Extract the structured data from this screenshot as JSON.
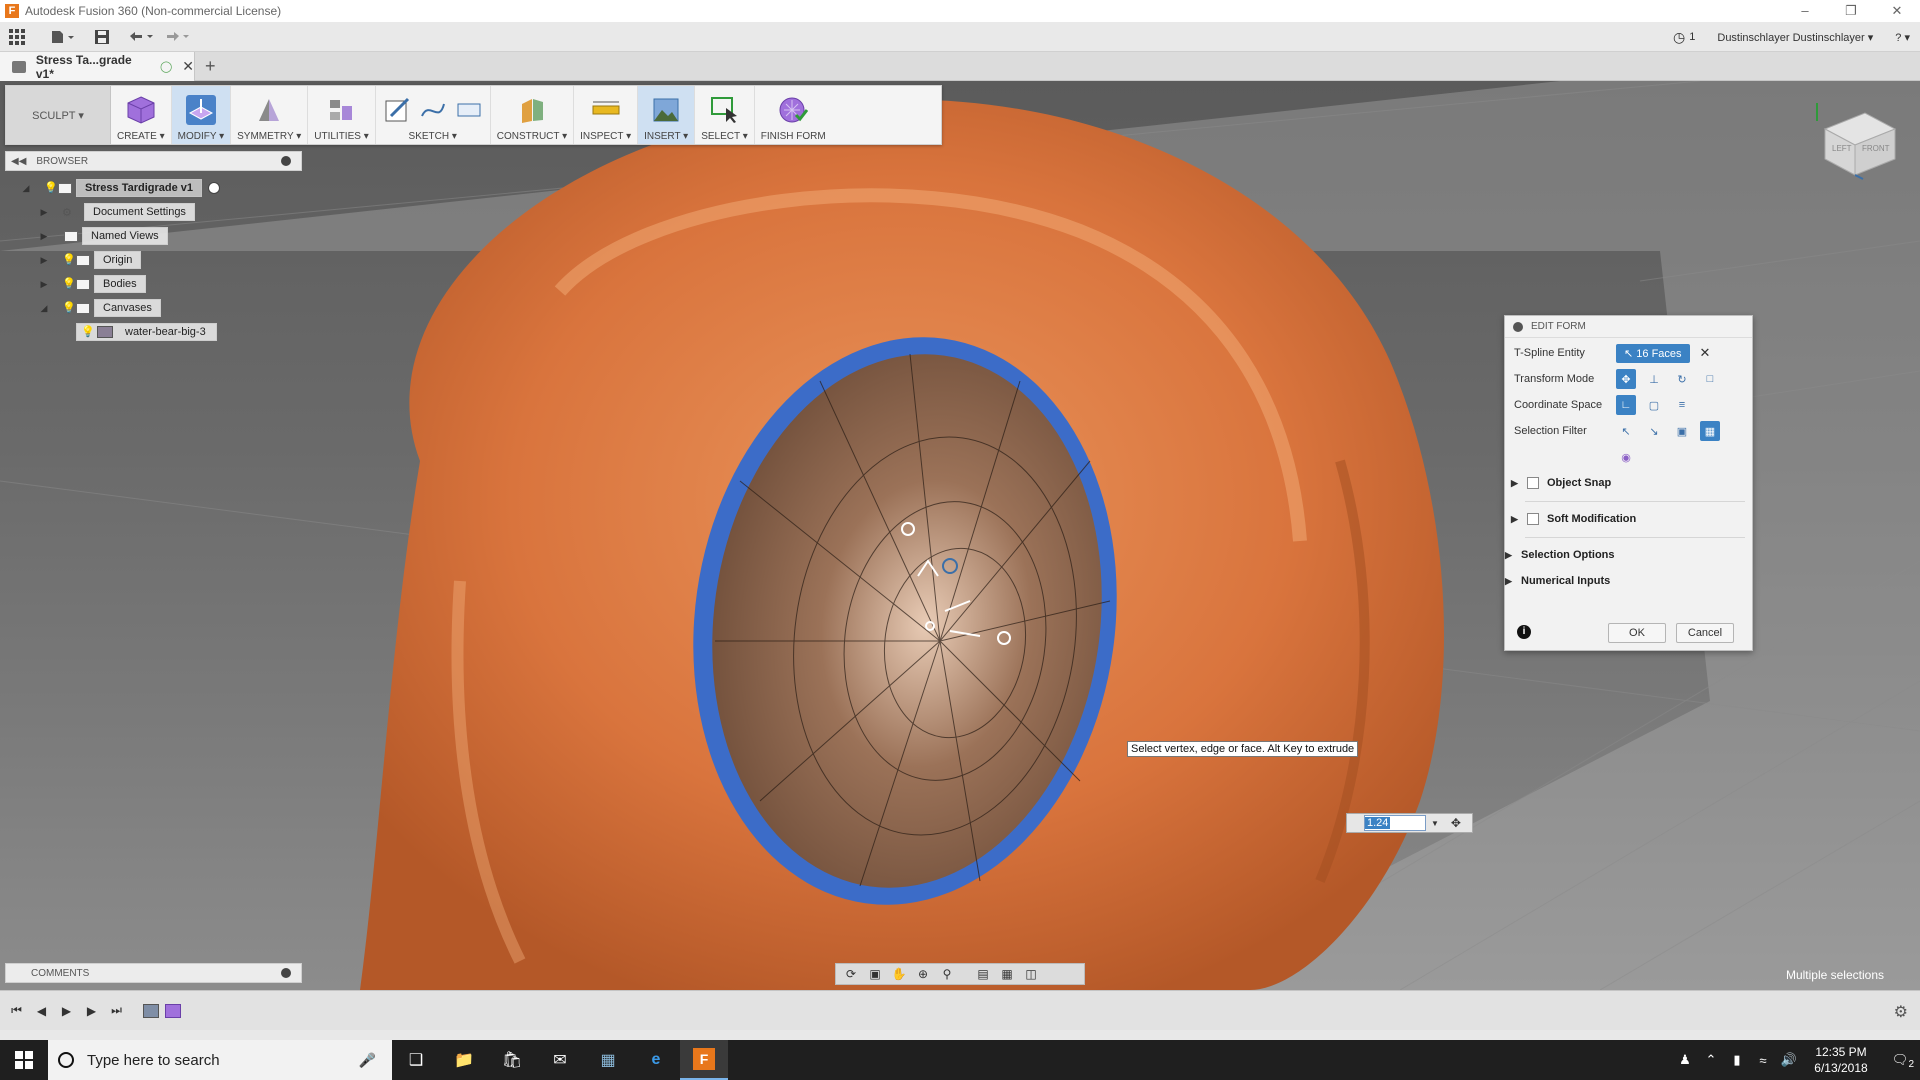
{
  "window": {
    "title": "Autodesk Fusion 360 (Non-commercial License)",
    "controls": [
      "–",
      "❐",
      "✕"
    ]
  },
  "qat": {
    "jobs_count": "1",
    "user": "Dustinschlayer Dustinschlayer ▾",
    "help": "? ▾"
  },
  "document_tab": {
    "name": "Stress Ta...grade v1*"
  },
  "ribbon": {
    "workspace": "SCULPT ▾",
    "groups": [
      {
        "label": "CREATE ▾",
        "icon": "create-cube-icon",
        "color": "#8b5fc6"
      },
      {
        "label": "MODIFY ▾",
        "icon": "modify-icon",
        "color": "#8b5fc6"
      },
      {
        "label": "SYMMETRY ▾",
        "icon": "symmetry-icon",
        "color": "#666"
      },
      {
        "label": "UTILITIES ▾",
        "icon": "utilities-icon",
        "color": "#666"
      },
      {
        "label": "SKETCH ▾",
        "icon": "sketch-icon",
        "color": "#3b6fa8"
      },
      {
        "label": "CONSTRUCT ▾",
        "icon": "construct-plane-icon",
        "color": "#d08b2a"
      },
      {
        "label": "INSPECT ▾",
        "icon": "measure-icon",
        "color": "#c89a1a"
      },
      {
        "label": "INSERT ▾",
        "icon": "insert-image-icon",
        "color": "#3b6fa8"
      },
      {
        "label": "SELECT ▾",
        "icon": "select-icon",
        "color": "#2f9a3a"
      },
      {
        "label": "FINISH FORM",
        "icon": "finish-form-icon",
        "color": "#8b5fc6"
      }
    ]
  },
  "browser": {
    "title": "BROWSER",
    "root": "Stress Tardigrade v1",
    "items": [
      {
        "label": "Document Settings"
      },
      {
        "label": "Named Views"
      },
      {
        "label": "Origin"
      },
      {
        "label": "Bodies"
      },
      {
        "label": "Canvases"
      }
    ],
    "canvas_child": "water-bear-big-3"
  },
  "edit_form": {
    "title": "EDIT FORM",
    "tspline_label": "T-Spline Entity",
    "tspline_value": "16 Faces",
    "transform_label": "Transform Mode",
    "coordinate_label": "Coordinate Space",
    "filter_label": "Selection Filter",
    "object_snap": "Object Snap",
    "soft_mod": "Soft Modification",
    "selection_options": "Selection Options",
    "numerical_inputs": "Numerical Inputs",
    "ok": "OK",
    "cancel": "Cancel"
  },
  "tooltip": "Select vertex, edge or face. Alt Key to extrude",
  "value_input": "1.24",
  "comments": {
    "title": "COMMENTS"
  },
  "status": {
    "multiple": "Multiple selections"
  },
  "viewcube": {
    "left": "LEFT",
    "front": "FRONT"
  },
  "taskbar": {
    "search_placeholder": "Type here to search",
    "time": "12:35 PM",
    "date": "6/13/2018",
    "notifications": "2"
  },
  "colors": {
    "accent": "#3b82c4",
    "model_orange": "#e58a4a",
    "rim_blue": "#3c6cc8"
  }
}
